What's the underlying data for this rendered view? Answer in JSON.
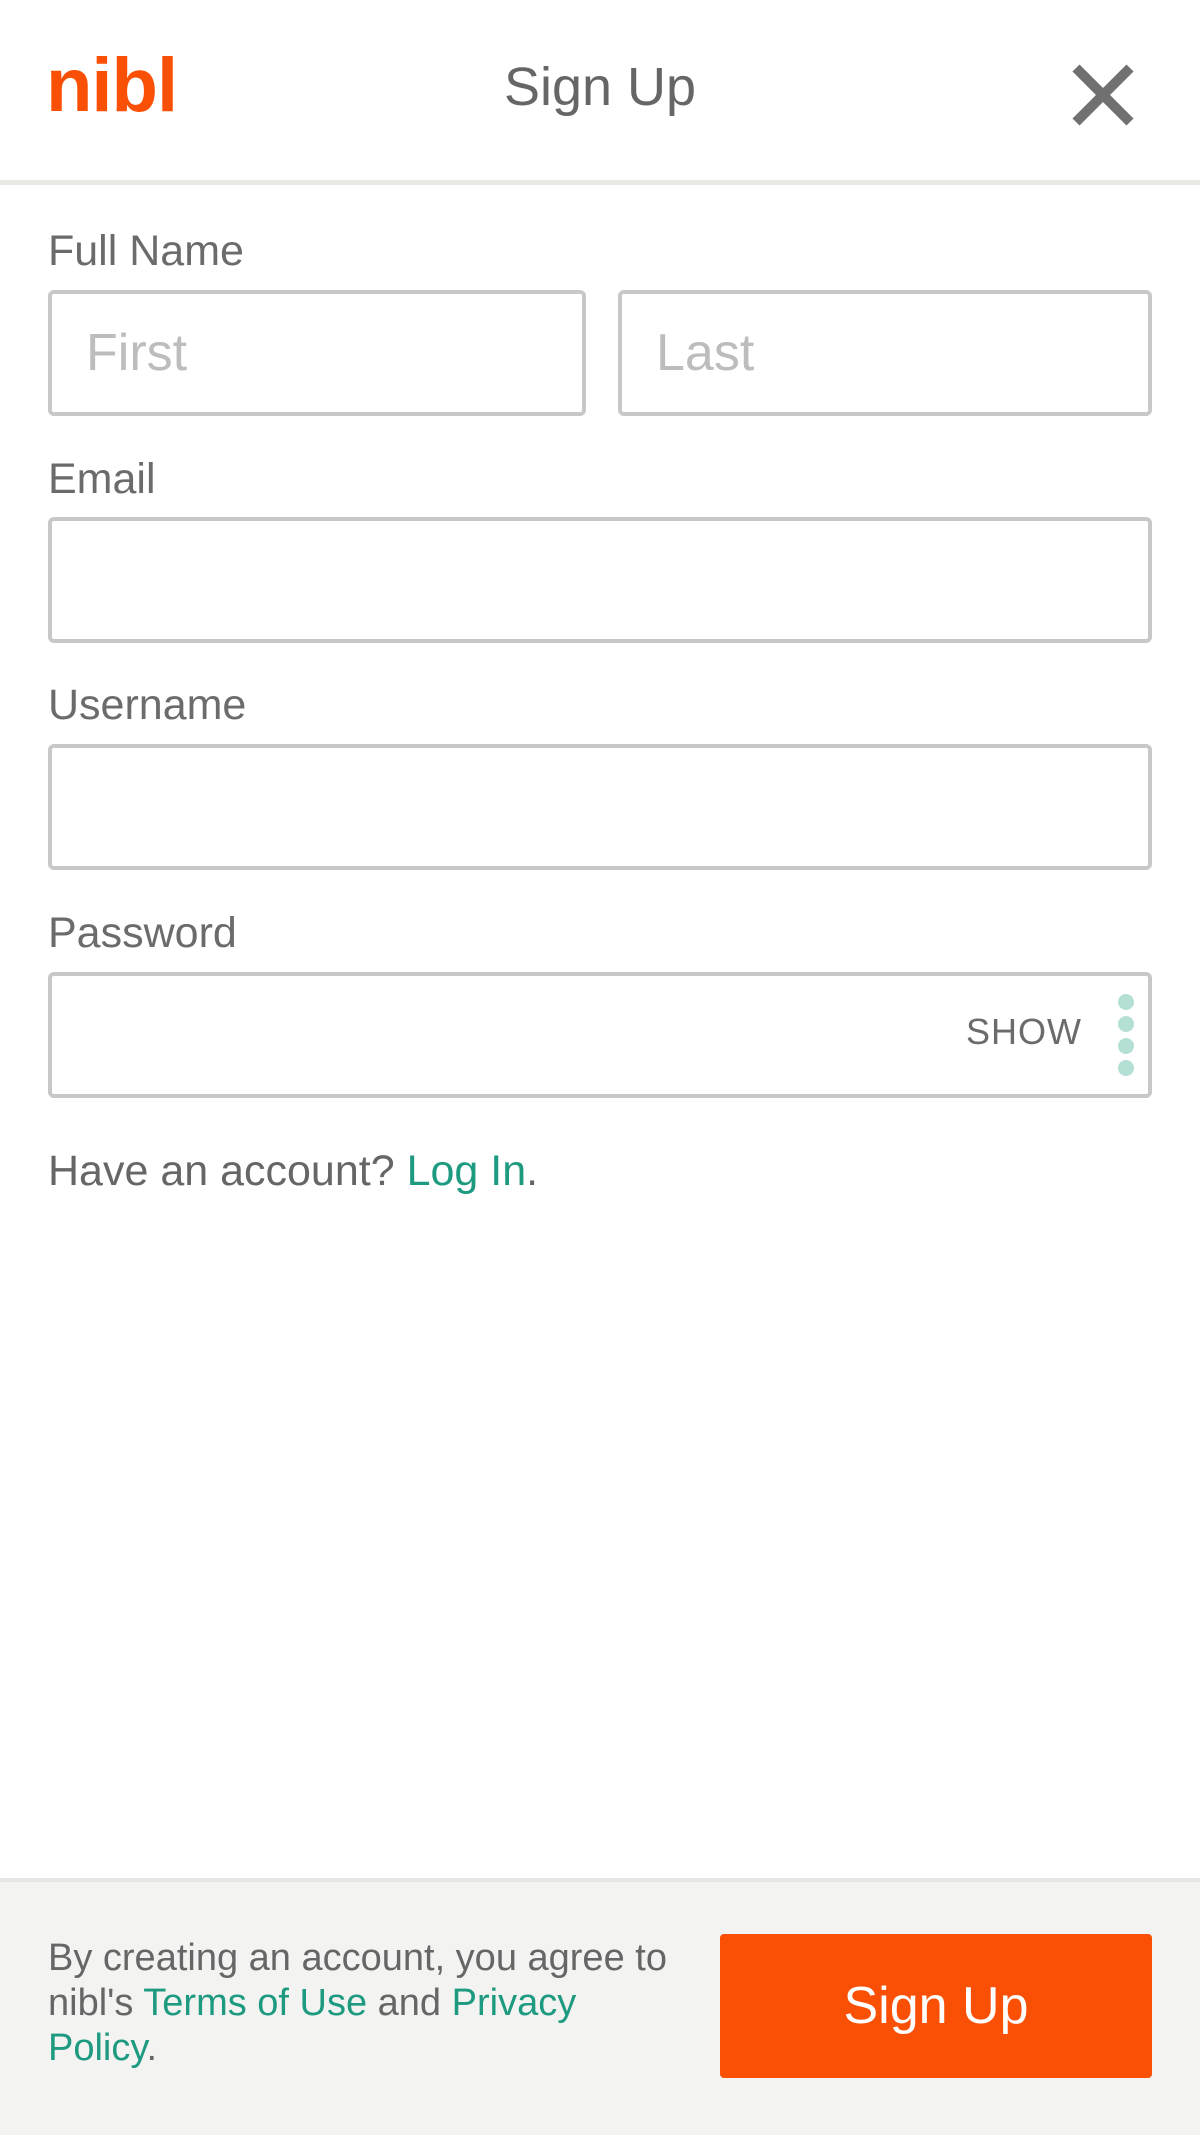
{
  "header": {
    "logo_text": "nibl",
    "title": "Sign Up",
    "close_icon": "close-icon"
  },
  "form": {
    "full_name_label": "Full Name",
    "first_placeholder": "First",
    "last_placeholder": "Last",
    "email_label": "Email",
    "email_value": "",
    "username_label": "Username",
    "username_value": "",
    "password_label": "Password",
    "password_value": "",
    "show_label": "SHOW",
    "password_icon": "more-dots-icon"
  },
  "account": {
    "prompt": "Have an account? ",
    "login_link": "Log In",
    "suffix": "."
  },
  "footer": {
    "legal_prefix": "By creating an account, you agree to nibl's ",
    "terms_link": "Terms of Use",
    "and_text": " and ",
    "privacy_link": "Privacy Policy",
    "legal_suffix": ".",
    "signup_button": "Sign Up"
  },
  "colors": {
    "brand": "#fa5005",
    "link": "#1d9a80",
    "field_border": "#c8c8c8",
    "footer_bg": "#f3f3f1"
  }
}
